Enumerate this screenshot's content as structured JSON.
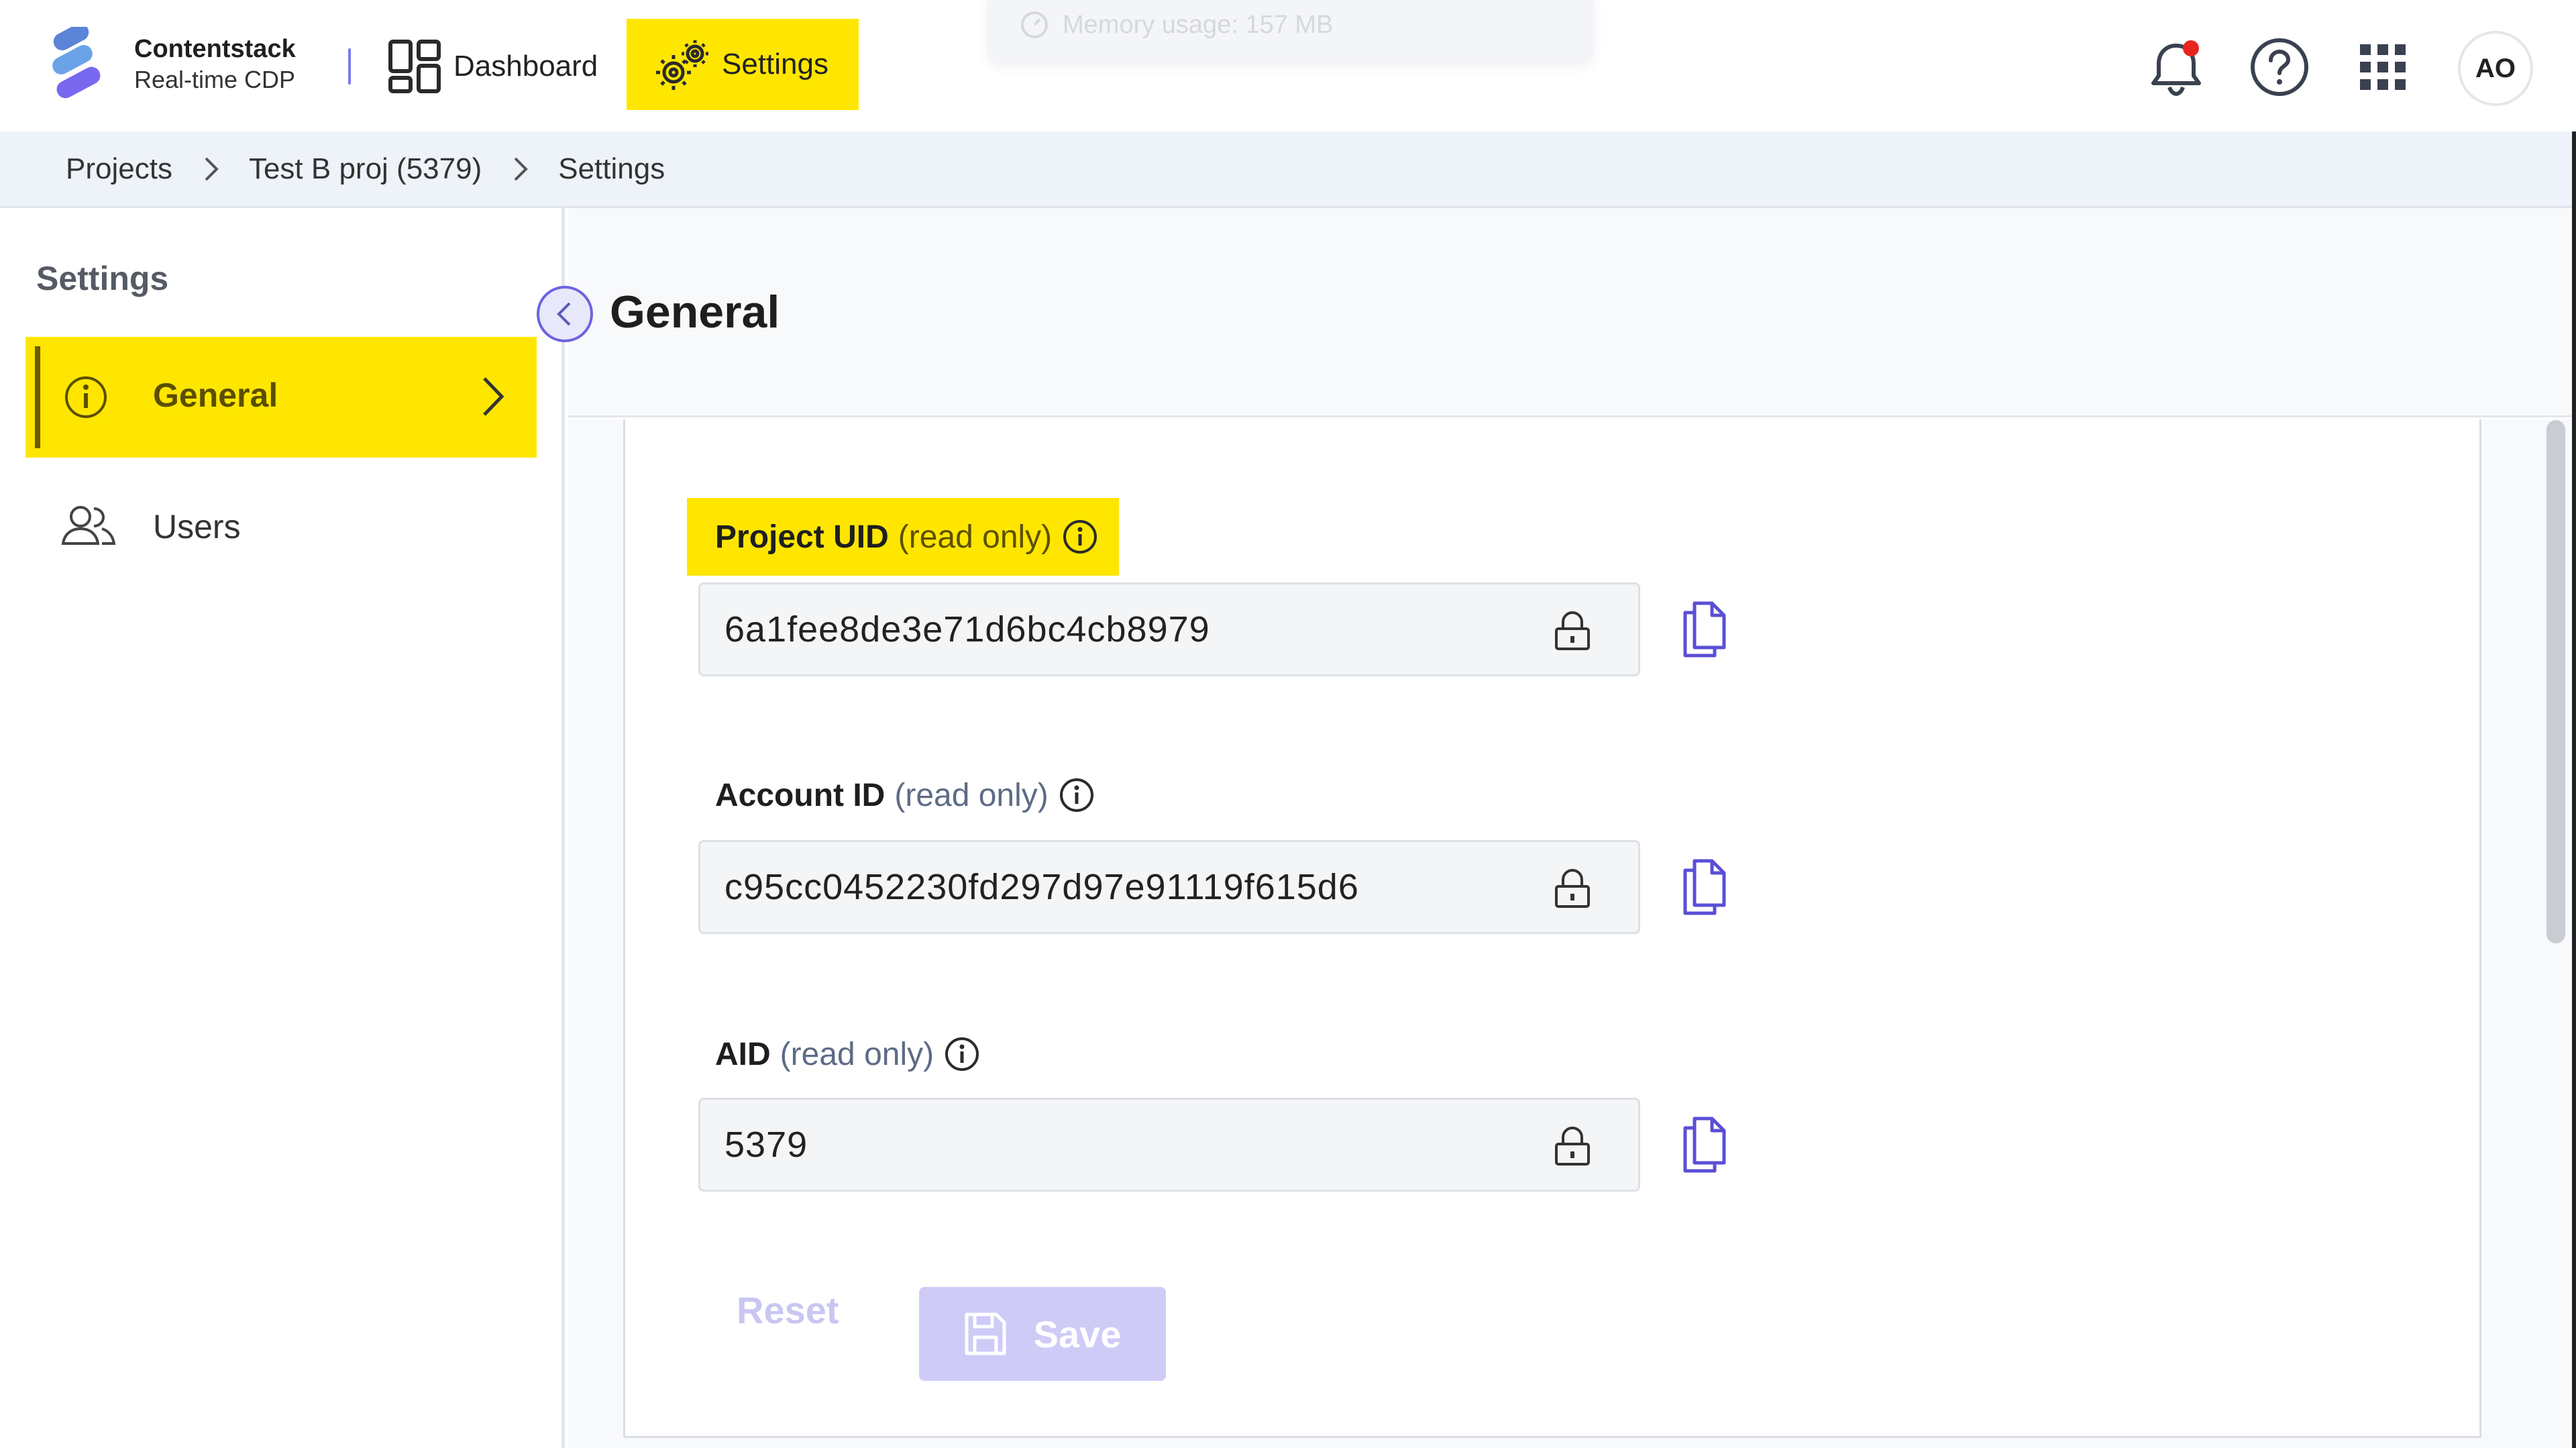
{
  "brand": {
    "name": "Contentstack",
    "product": "Real-time CDP"
  },
  "nav": {
    "dashboard": "Dashboard",
    "settings": "Settings"
  },
  "toast": {
    "text": "Memory usage: 157 MB"
  },
  "header": {
    "avatar_initials": "AO"
  },
  "breadcrumb": [
    "Projects",
    "Test B proj (5379)",
    "Settings"
  ],
  "sidebar": {
    "title": "Settings",
    "items": [
      {
        "label": "General",
        "active": true
      },
      {
        "label": "Users",
        "active": false
      }
    ]
  },
  "page": {
    "title": "General"
  },
  "fields": [
    {
      "name": "Project UID",
      "suffix": "(read only)",
      "value": "6a1fee8de3e71d6bc4cb8979"
    },
    {
      "name": "Account ID",
      "suffix": "(read only)",
      "value": "c95cc0452230fd297d97e91119f615d6"
    },
    {
      "name": "AID",
      "suffix": "(read only)",
      "value": "5379"
    }
  ],
  "actions": {
    "reset": "Reset",
    "save": "Save"
  },
  "colors": {
    "highlight": "#ffe600",
    "accent": "#6c63e0",
    "notification_dot": "#e8251f"
  }
}
